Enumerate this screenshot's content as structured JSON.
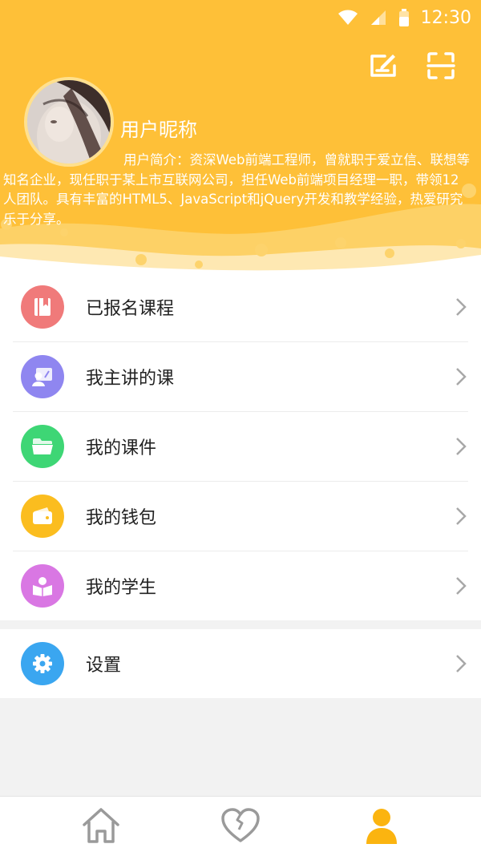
{
  "status_bar": {
    "time": "12:30"
  },
  "profile": {
    "nickname": "用户昵称",
    "intro": "用户简介：资深Web前端工程师，曾就职于爱立信、联想等知名企业，现任职于某上市互联网公司，担任Web前端项目经理一职，带领12人团队。具有丰富的HTML5、JavaScript和jQuery开发和教学经验，热爱研究乐于分享。"
  },
  "menu": [
    {
      "label": "已报名课程",
      "icon": "book-icon",
      "color": "#f07a7a"
    },
    {
      "label": "我主讲的课",
      "icon": "teacher-icon",
      "color": "#8f86f0"
    },
    {
      "label": "我的课件",
      "icon": "folder-icon",
      "color": "#3ed675"
    },
    {
      "label": "我的钱包",
      "icon": "wallet-icon",
      "color": "#fbbd1f"
    },
    {
      "label": "我的学生",
      "icon": "student-icon",
      "color": "#d977e3"
    }
  ],
  "settings": {
    "label": "设置",
    "icon": "gear-icon",
    "color": "#3aa6f0"
  },
  "tabs": [
    {
      "name": "home",
      "icon": "home-icon"
    },
    {
      "name": "favorites",
      "icon": "heart-icon"
    },
    {
      "name": "profile",
      "icon": "user-icon",
      "active": true
    }
  ],
  "colors": {
    "accent": "#fec038",
    "tab_active": "#fbb410",
    "tab_inactive": "#9a9a9a"
  }
}
